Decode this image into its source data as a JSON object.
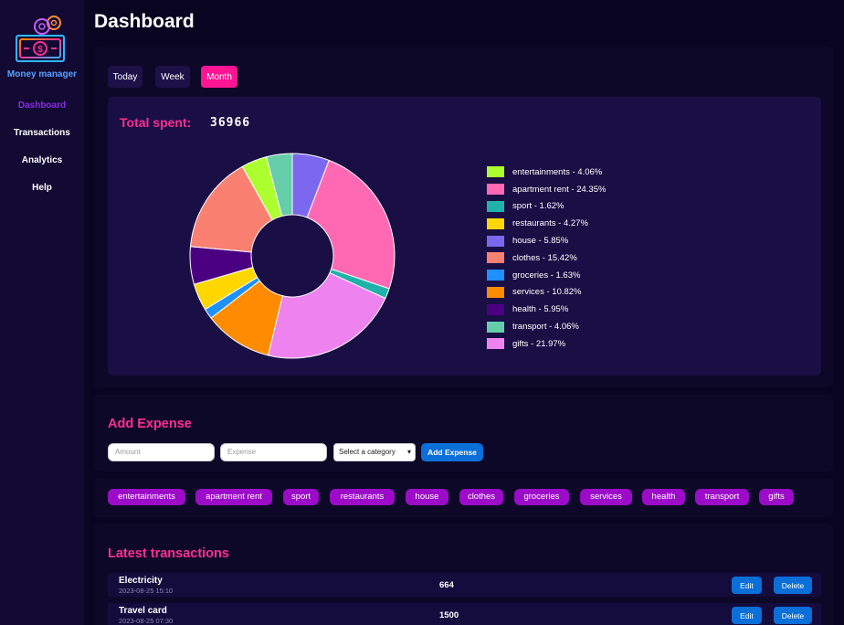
{
  "sidebar": {
    "brand": "Money manager",
    "nav": [
      "Dashboard",
      "Transactions",
      "Analytics",
      "Help"
    ],
    "active": "Dashboard",
    "logo_icon": "money-gear-logo"
  },
  "header": {
    "title": "Dashboard"
  },
  "period": {
    "buttons": [
      "Today",
      "Week",
      "Month"
    ],
    "active": "Month"
  },
  "summary": {
    "total_label": "Total spent:",
    "total_value": "36966"
  },
  "chart_data": {
    "type": "pie",
    "donut": true,
    "categories": [
      "entertainments",
      "apartment rent",
      "sport",
      "restaurants",
      "house",
      "clothes",
      "groceries",
      "services",
      "health",
      "transport",
      "gifts"
    ],
    "values": [
      4.06,
      24.35,
      1.62,
      4.27,
      5.85,
      15.42,
      1.63,
      10.82,
      5.95,
      4.06,
      21.97
    ],
    "colors": [
      "#adff2f",
      "#ff69b4",
      "#20b2aa",
      "#ffd700",
      "#7b68ee",
      "#fa8072",
      "#1e90ff",
      "#ff8c00",
      "#4b0082",
      "#66cdaa",
      "#ee82ee"
    ],
    "legend_labels": [
      "entertainments - 4.06%",
      "apartment rent - 24.35%",
      "sport - 1.62%",
      "restaurants - 4.27%",
      "house - 5.85%",
      "clothes - 15.42%",
      "groceries - 1.63%",
      "services - 10.82%",
      "health - 5.95%",
      "transport - 4.06%",
      "gifts - 21.97%"
    ],
    "legend_position": "right"
  },
  "add_expense": {
    "title": "Add Expense",
    "amount_placeholder": "Amount",
    "expense_placeholder": "Expense",
    "category_selected": "Select a category",
    "button": "Add Expense"
  },
  "category_chips": [
    "entertainments",
    "apartment rent",
    "sport",
    "restaurants",
    "house",
    "clothes",
    "groceries",
    "services",
    "health",
    "transport",
    "gifts"
  ],
  "transactions": {
    "title": "Latest transactions",
    "edit_label": "Edit",
    "delete_label": "Delete",
    "rows": [
      {
        "name": "Electricity",
        "date": "2023-08-25 15:10",
        "amount": "664"
      },
      {
        "name": "Travel card",
        "date": "2023-08-25 07:30",
        "amount": "1500"
      }
    ]
  },
  "colors": {
    "accent": "#ff2e93",
    "active_nav": "#8a2be2",
    "button_blue": "#0a6fd8",
    "chip": "#9b0bc8"
  }
}
